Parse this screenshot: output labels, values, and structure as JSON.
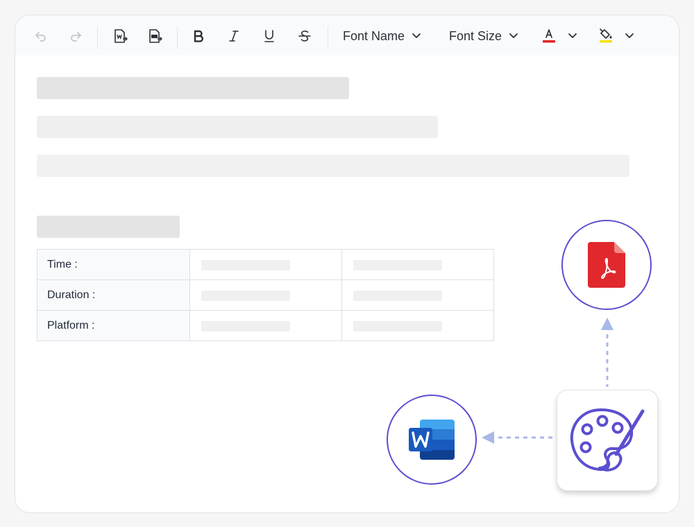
{
  "toolbar": {
    "font_name_label": "Font Name",
    "font_size_label": "Font Size",
    "font_color_swatch": "#e02424",
    "highlight_swatch": "#f5e400"
  },
  "table": {
    "rows": [
      {
        "label": "Time :"
      },
      {
        "label": "Duration :"
      },
      {
        "label": "Platform :"
      }
    ]
  },
  "colors": {
    "accent": "#5b4fcf",
    "pdf_red": "#e0282d",
    "word_blue": "#185abd"
  }
}
